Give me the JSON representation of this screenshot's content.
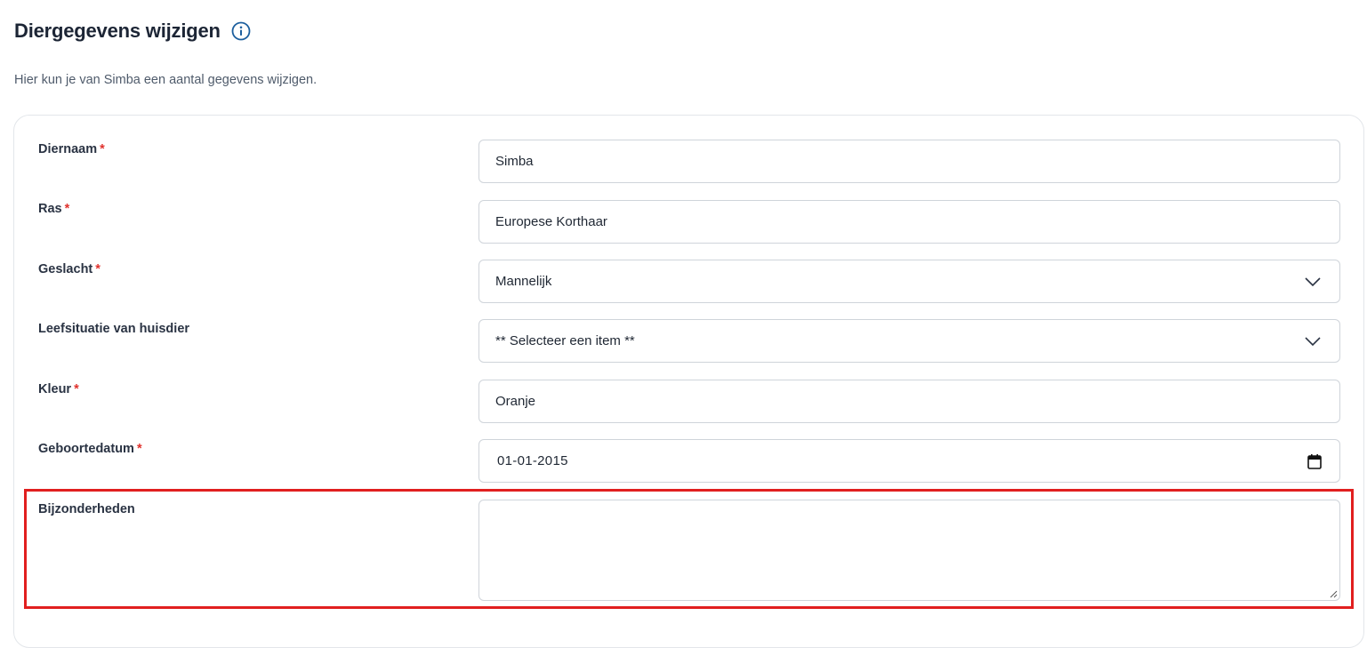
{
  "header": {
    "title": "Diergegevens wijzigen",
    "subtitle": "Hier kun je van Simba een aantal gegevens wijzigen."
  },
  "colors": {
    "accent": "#1d5f9e",
    "required": "#e0322d",
    "highlight": "#e11f1f"
  },
  "required_marker": "*",
  "form": {
    "diernaam": {
      "label": "Diernaam",
      "value": "Simba"
    },
    "ras": {
      "label": "Ras",
      "value": "Europese Korthaar"
    },
    "geslacht": {
      "label": "Geslacht",
      "value": "Mannelijk"
    },
    "leefsituatie": {
      "label": "Leefsituatie van huisdier",
      "value": "** Selecteer een item **"
    },
    "kleur": {
      "label": "Kleur",
      "value": "Oranje"
    },
    "geboortedatum": {
      "label": "Geboortedatum",
      "value": "01-01-2015"
    },
    "bijzonderheden": {
      "label": "Bijzonderheden",
      "value": ""
    }
  },
  "icons": [
    "info-icon",
    "chevron-down-icon",
    "calendar-icon",
    "resize-handle-icon"
  ]
}
